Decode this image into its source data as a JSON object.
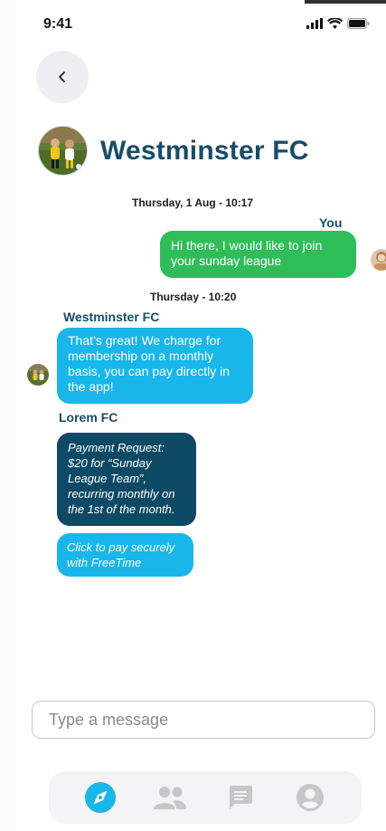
{
  "status_bar": {
    "time": "9:41"
  },
  "header": {
    "title": "Westminster FC"
  },
  "conversation": {
    "timestamp_1": "Thursday, 1 Aug - 10:17",
    "you_label": "You",
    "message_1": "Hi there, I would like to join your sunday league",
    "timestamp_2": "Thursday - 10:20",
    "sender_1": "Westminster FC",
    "message_2": "That’s great! We charge for membership on a monthly basis, you can pay directly in the app!",
    "sender_2": "Lorem FC",
    "payment_request": "Payment Request: $20 for “Sunday League Team”, recurring monthly on the 1st of the month.",
    "pay_link": "Click to pay securely with FreeTime"
  },
  "composer": {
    "placeholder": "Type a message"
  },
  "nav": {
    "items": [
      "explore-icon",
      "team-icon",
      "chat-icon",
      "profile-icon"
    ]
  },
  "colors": {
    "brand": "#184d68",
    "sent_bubble": "#2ebd59",
    "received_bubble": "#19b6ea",
    "payment_bubble": "#0e4a66"
  }
}
